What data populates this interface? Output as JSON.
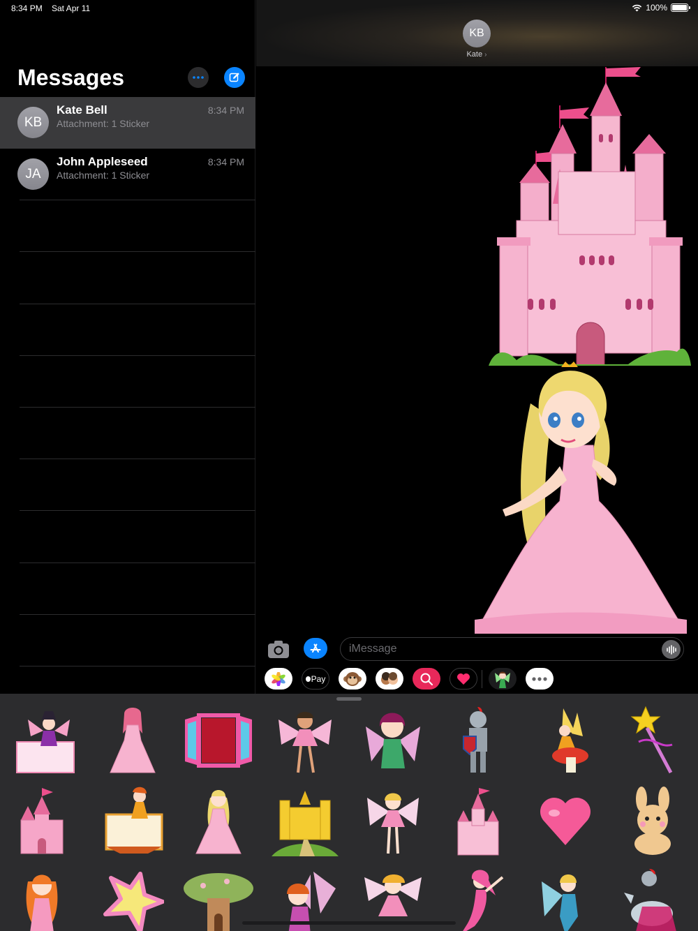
{
  "status_bar": {
    "time": "8:34 PM",
    "date": "Sat Apr 11",
    "battery": "100%"
  },
  "sidebar": {
    "title": "Messages",
    "conversations": [
      {
        "initials": "KB",
        "name": "Kate Bell",
        "preview": "Attachment: 1 Sticker",
        "time": "8:34 PM",
        "selected": true
      },
      {
        "initials": "JA",
        "name": "John Appleseed",
        "preview": "Attachment: 1 Sticker",
        "time": "8:34 PM",
        "selected": false
      }
    ]
  },
  "chat": {
    "contact_initials": "KB",
    "contact_name": "Kate",
    "stickers": [
      "pink-castle-sticker",
      "blonde-princess-sticker"
    ]
  },
  "composer": {
    "placeholder": "iMessage"
  },
  "app_strip": {
    "apple_pay_label": "Pay",
    "apps": [
      "photos-icon",
      "apple-pay-icon",
      "monkey-animoji-icon",
      "memoji-icon",
      "image-search-icon",
      "digital-touch-icon",
      "fairy-stickers-icon",
      "more-apps-icon"
    ]
  },
  "sticker_drawer": {
    "stickers": [
      "fairy-on-sign",
      "princess-pink-dress",
      "open-window",
      "ballerina-fairy",
      "brunette-fairy",
      "knight-armor",
      "fairy-on-mushroom",
      "magic-wand",
      "small-pink-castle",
      "autumn-fairy-sign",
      "blonde-princess",
      "golden-castle",
      "blonde-fairy",
      "pink-castle",
      "pink-heart",
      "bunny",
      "redhead-princess",
      "yellow-star",
      "mushroom-house",
      "sitting-fairy",
      "dancing-fairy",
      "mermaid",
      "teal-fairy",
      "knight-on-horse"
    ]
  },
  "colors": {
    "accent": "#0a84ff",
    "selected_row": "#3a3a3c",
    "drawer_bg": "#2c2c2e"
  }
}
